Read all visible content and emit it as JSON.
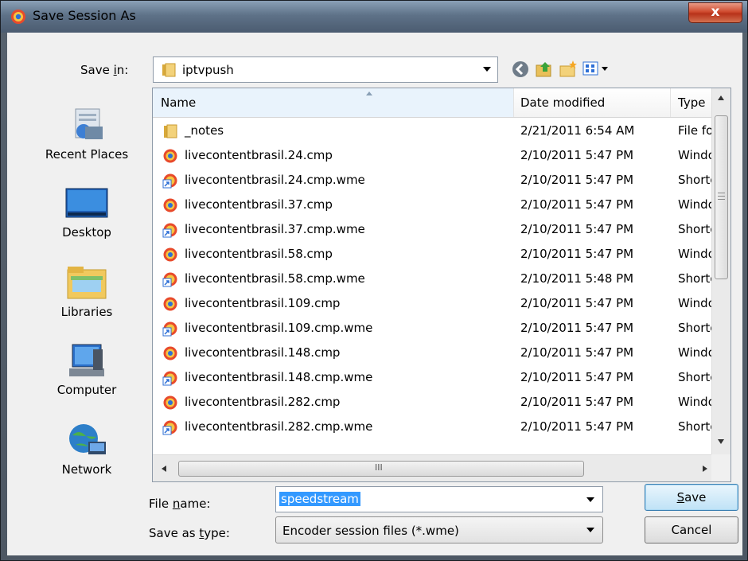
{
  "window": {
    "title": "Save Session As",
    "close_label": "x"
  },
  "save_in": {
    "label_pre": "Save ",
    "label_u": "i",
    "label_post": "n:",
    "value": "iptvpush"
  },
  "places": [
    {
      "id": "recent",
      "label": "Recent Places",
      "icon": "recent-places-icon"
    },
    {
      "id": "desktop",
      "label": "Desktop",
      "icon": "desktop-icon"
    },
    {
      "id": "libraries",
      "label": "Libraries",
      "icon": "libraries-icon"
    },
    {
      "id": "computer",
      "label": "Computer",
      "icon": "computer-icon"
    },
    {
      "id": "network",
      "label": "Network",
      "icon": "network-icon"
    }
  ],
  "columns": {
    "name": "Name",
    "date": "Date modified",
    "type": "Type"
  },
  "files": [
    {
      "icon": "folder-icon",
      "name": "_notes",
      "date": "2/21/2011 6:54 AM",
      "type": "File fol"
    },
    {
      "icon": "media-file-icon",
      "name": "livecontentbrasil.24.cmp",
      "date": "2/10/2011 5:47 PM",
      "type": "Windo"
    },
    {
      "icon": "shortcut-icon",
      "name": "livecontentbrasil.24.cmp.wme",
      "date": "2/10/2011 5:47 PM",
      "type": "Shortc"
    },
    {
      "icon": "media-file-icon",
      "name": "livecontentbrasil.37.cmp",
      "date": "2/10/2011 5:47 PM",
      "type": "Windo"
    },
    {
      "icon": "shortcut-icon",
      "name": "livecontentbrasil.37.cmp.wme",
      "date": "2/10/2011 5:47 PM",
      "type": "Shortc"
    },
    {
      "icon": "media-file-icon",
      "name": "livecontentbrasil.58.cmp",
      "date": "2/10/2011 5:47 PM",
      "type": "Windo"
    },
    {
      "icon": "shortcut-icon",
      "name": "livecontentbrasil.58.cmp.wme",
      "date": "2/10/2011 5:48 PM",
      "type": "Shortc"
    },
    {
      "icon": "media-file-icon",
      "name": "livecontentbrasil.109.cmp",
      "date": "2/10/2011 5:47 PM",
      "type": "Windo"
    },
    {
      "icon": "shortcut-icon",
      "name": "livecontentbrasil.109.cmp.wme",
      "date": "2/10/2011 5:47 PM",
      "type": "Shortc"
    },
    {
      "icon": "media-file-icon",
      "name": "livecontentbrasil.148.cmp",
      "date": "2/10/2011 5:47 PM",
      "type": "Windo"
    },
    {
      "icon": "shortcut-icon",
      "name": "livecontentbrasil.148.cmp.wme",
      "date": "2/10/2011 5:47 PM",
      "type": "Shortc"
    },
    {
      "icon": "media-file-icon",
      "name": "livecontentbrasil.282.cmp",
      "date": "2/10/2011 5:47 PM",
      "type": "Windo"
    },
    {
      "icon": "shortcut-icon",
      "name": "livecontentbrasil.282.cmp.wme",
      "date": "2/10/2011 5:47 PM",
      "type": "Shortc"
    }
  ],
  "hscroll_grip": "III",
  "file_name": {
    "label_pre": "File ",
    "label_u": "n",
    "label_post": "ame:",
    "value": "speedstream"
  },
  "save_as_type": {
    "label_pre": "Save as ",
    "label_u": "t",
    "label_post": "ype:",
    "value": "Encoder session files (*.wme)"
  },
  "buttons": {
    "save_u": "S",
    "save_rest": "ave",
    "cancel": "Cancel"
  }
}
